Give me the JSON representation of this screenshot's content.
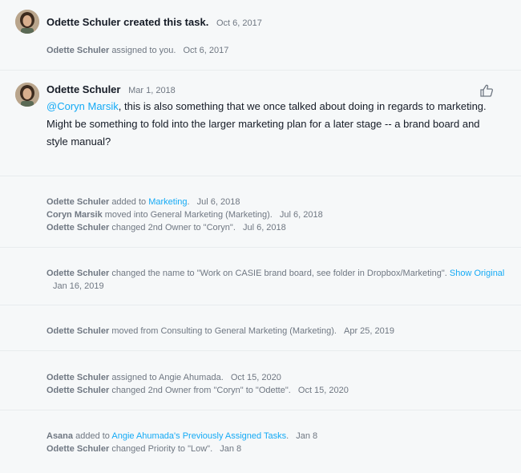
{
  "created": {
    "actor": "Odette Schuler",
    "action": "created this task.",
    "date": "Oct 6, 2017"
  },
  "assigned": {
    "actor": "Odette Schuler",
    "text": "assigned to you.",
    "date": "Oct 6, 2017"
  },
  "comment": {
    "author": "Odette Schuler",
    "date": "Mar 1, 2018",
    "mention": "@Coryn Marsik",
    "body": ", this is also something that we once talked about doing in regards to marketing. Might be something to fold into the larger marketing plan for a later stage -- a brand board and style manual?"
  },
  "events": [
    [
      {
        "actor": "Odette Schuler",
        "pre": "added to",
        "link": "Marketing",
        "post": ".",
        "date": "Jul 6, 2018"
      },
      {
        "actor": "Coryn Marsik",
        "pre": "moved into General Marketing (Marketing).",
        "link": "",
        "post": "",
        "date": "Jul 6, 2018"
      },
      {
        "actor": "Odette Schuler",
        "pre": "changed 2nd Owner to \"Coryn\".",
        "link": "",
        "post": "",
        "date": "Jul 6, 2018"
      }
    ],
    [
      {
        "actor": "Odette Schuler",
        "pre": "changed the name to \"Work on CASIE brand board, see folder in Dropbox/Marketing\".",
        "link": "Show Original",
        "post": "",
        "date": "Jan 16, 2019"
      }
    ],
    [
      {
        "actor": "Odette Schuler",
        "pre": "moved from Consulting to General Marketing (Marketing).",
        "link": "",
        "post": "",
        "date": "Apr 25, 2019"
      }
    ],
    [
      {
        "actor": "Odette Schuler",
        "pre": "assigned to Angie Ahumada.",
        "link": "",
        "post": "",
        "date": "Oct 15, 2020"
      },
      {
        "actor": "Odette Schuler",
        "pre": "changed 2nd Owner from \"Coryn\" to \"Odette\".",
        "link": "",
        "post": "",
        "date": "Oct 15, 2020"
      }
    ],
    [
      {
        "actor": "Asana",
        "pre": "added to",
        "link": "Angie Ahumada's Previously Assigned Tasks",
        "post": ".",
        "date": "Jan 8"
      },
      {
        "actor": "Odette Schuler",
        "pre": "changed Priority to \"Low\".",
        "link": "",
        "post": "",
        "date": "Jan 8"
      }
    ]
  ]
}
